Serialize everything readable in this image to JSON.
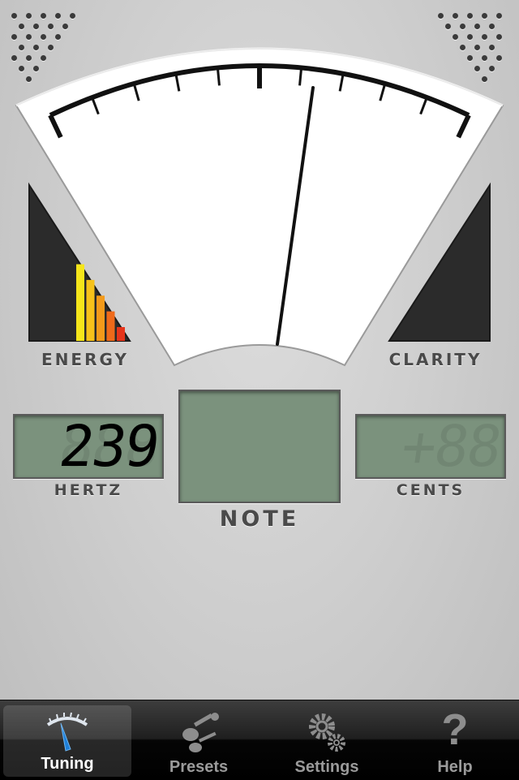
{
  "meter": {
    "energy_label": "ENERGY",
    "clarity_label": "CLARITY",
    "needle_level": 0.62,
    "energy_level": 0.5
  },
  "readouts": {
    "hertz_value": "239",
    "hertz_label": "HERTZ",
    "note_value": "",
    "note_label": "NOTE",
    "cents_value": "",
    "cents_label": "CENTS"
  },
  "tabbar": {
    "tabs": [
      {
        "label": "Tuning",
        "icon": "tuning-gauge-icon",
        "active": true
      },
      {
        "label": "Presets",
        "icon": "guitars-icon",
        "active": false
      },
      {
        "label": "Settings",
        "icon": "gears-icon",
        "active": false
      },
      {
        "label": "Help",
        "icon": "question-mark-icon",
        "active": false
      }
    ]
  },
  "colors": {
    "lcd": "#7b927d",
    "active_tab_icon": "#1e7fd8",
    "energy_bar_colors": [
      "#f6e61a",
      "#f6c21a",
      "#f39a1a",
      "#ef6a1a",
      "#e6341a"
    ]
  }
}
